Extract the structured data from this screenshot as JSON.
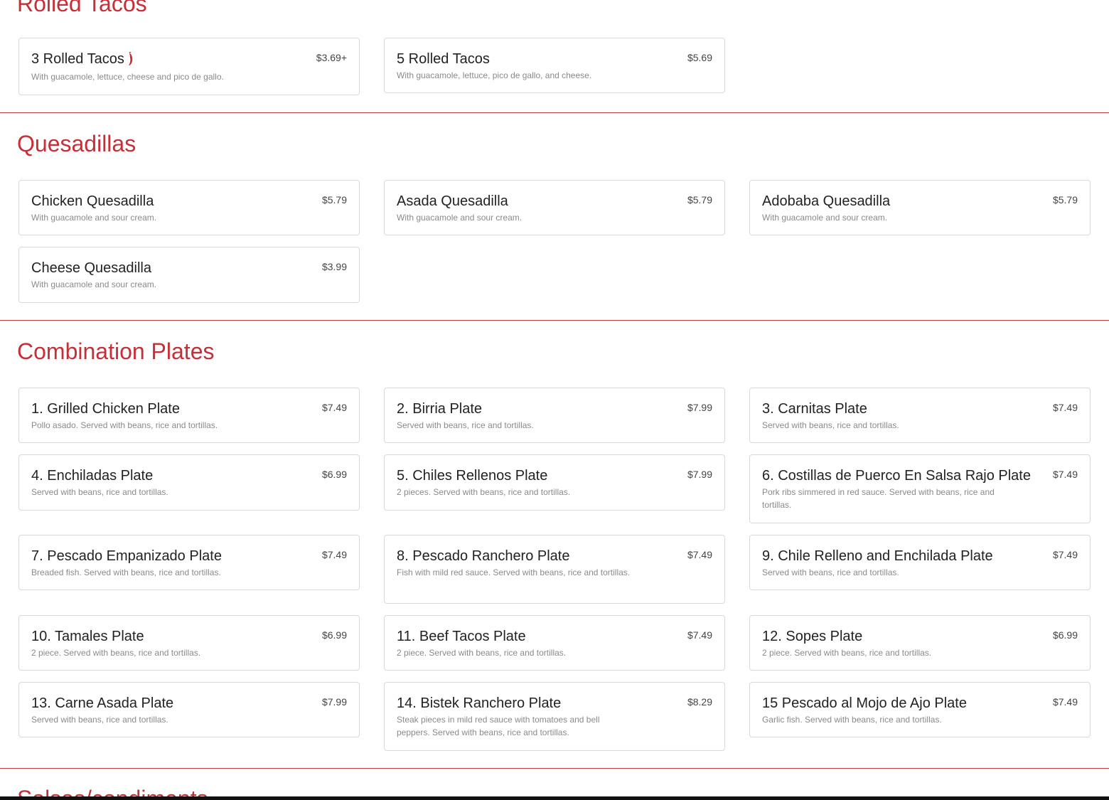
{
  "sections": {
    "rolled_tacos": {
      "title": "Rolled Tacos",
      "items": [
        {
          "name": "3 Rolled Tacos",
          "price": "$3.69+",
          "description": "With guacamole, lettuce, cheese and pico de gallo.",
          "icon": "chili-pepper-icon"
        },
        {
          "name": "5 Rolled Tacos",
          "price": "$5.69",
          "description": "With guacamole, lettuce, pico de gallo, and cheese."
        }
      ]
    },
    "quesadillas": {
      "title": "Quesadillas",
      "items": [
        {
          "name": "Chicken Quesadilla",
          "price": "$5.79",
          "description": "With guacamole and sour cream."
        },
        {
          "name": "Asada Quesadilla",
          "price": "$5.79",
          "description": "With guacamole and sour cream."
        },
        {
          "name": "Adobaba Quesadilla",
          "price": "$5.79",
          "description": "With guacamole and sour cream."
        },
        {
          "name": "Cheese Quesadilla",
          "price": "$3.99",
          "description": "With guacamole and sour cream."
        }
      ]
    },
    "combination_plates": {
      "title": "Combination Plates",
      "items": [
        {
          "name": "1. Grilled Chicken Plate",
          "price": "$7.49",
          "description": "Pollo asado. Served with beans, rice and tortillas."
        },
        {
          "name": "2. Birria Plate",
          "price": "$7.99",
          "description": "Served with beans, rice and tortillas."
        },
        {
          "name": "3. Carnitas Plate",
          "price": "$7.49",
          "description": "Served with beans, rice and tortillas."
        },
        {
          "name": "4. Enchiladas Plate",
          "price": "$6.99",
          "description": "Served with beans, rice and tortillas."
        },
        {
          "name": "5. Chiles Rellenos Plate",
          "price": "$7.99",
          "description": "2 pieces. Served with beans, rice and tortillas."
        },
        {
          "name": "6. Costillas de Puerco En Salsa Rajo Plate",
          "price": "$7.49",
          "description": "Pork ribs simmered in red sauce. Served with beans, rice and tortillas."
        },
        {
          "name": "7. Pescado Empanizado Plate",
          "price": "$7.49",
          "description": "Breaded fish. Served with beans, rice and tortillas."
        },
        {
          "name": "8. Pescado Ranchero Plate",
          "price": "$7.49",
          "description": "Fish with mild red sauce. Served with beans, rice and tortillas."
        },
        {
          "name": "9. Chile Relleno and Enchilada Plate",
          "price": "$7.49",
          "description": "Served with beans, rice and tortillas."
        },
        {
          "name": "10. Tamales Plate",
          "price": "$6.99",
          "description": "2 piece. Served with beans, rice and tortillas."
        },
        {
          "name": "11. Beef Tacos Plate",
          "price": "$7.49",
          "description": "2 piece. Served with beans, rice and tortillas."
        },
        {
          "name": "12. Sopes Plate",
          "price": "$6.99",
          "description": "2 piece. Served with beans, rice and tortillas."
        },
        {
          "name": "13. Carne Asada Plate",
          "price": "$7.99",
          "description": "Served with beans, rice and tortillas."
        },
        {
          "name": "14. Bistek Ranchero Plate",
          "price": "$8.29",
          "description": "Steak pieces in mild red sauce with tomatoes and bell peppers. Served with beans, rice and tortillas."
        },
        {
          "name": "15 Pescado al Mojo de Ajo Plate",
          "price": "$7.49",
          "description": "Garlic fish. Served with beans, rice and tortillas."
        }
      ]
    },
    "salsas": {
      "title": "Salsas/condiments"
    }
  },
  "colors": {
    "accent": "#c62f37",
    "card_border": "#d9d9d9",
    "item_name": "#222222",
    "item_desc": "#8a8a8a"
  }
}
